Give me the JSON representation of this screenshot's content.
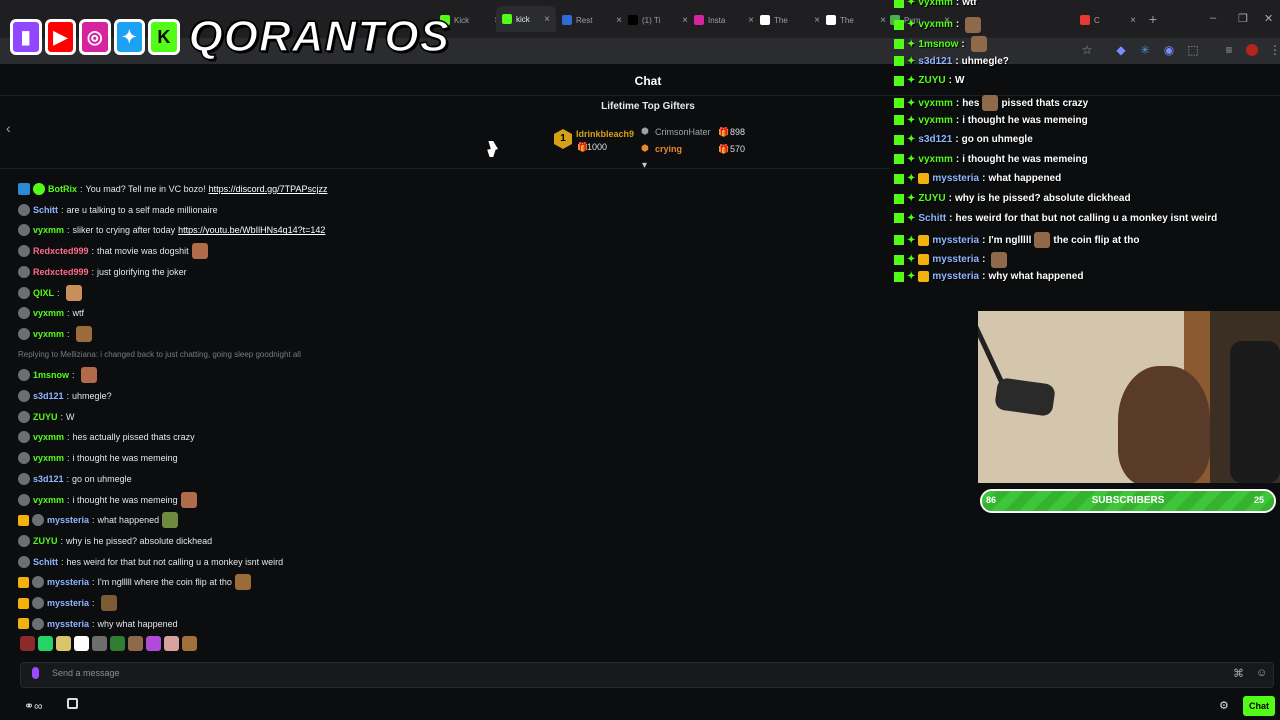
{
  "browser": {
    "tabs": [
      {
        "label": "Kick",
        "favicon_color": "#53fc18"
      },
      {
        "label": "kick",
        "favicon_color": "#53fc18",
        "active": true
      },
      {
        "label": "Rest",
        "favicon_color": "#2f6bd6"
      },
      {
        "label": "(1) Ti",
        "favicon_color": "#000000"
      },
      {
        "label": "Insta",
        "favicon_color": "#d6249f"
      },
      {
        "label": "The",
        "favicon_color": "#ffffff"
      },
      {
        "label": "The",
        "favicon_color": "#ffffff"
      },
      {
        "label": "Pum",
        "favicon_color": "#4caf50"
      },
      {
        "label": "C",
        "favicon_color": "#e53935"
      }
    ],
    "new_tab": "+",
    "window_min": "–",
    "window_max": "❐",
    "window_close": "✕"
  },
  "logo": {
    "text": "QORANTOS"
  },
  "chat": {
    "title": "Chat",
    "gifters_title": "Lifetime Top Gifters",
    "gifters": [
      {
        "rank": "1",
        "name": "Idrinkbleach9",
        "count": "1000",
        "color": "#d4a017"
      },
      {
        "name": "CrimsonHater",
        "count": "898",
        "color": "#9ea3a8"
      },
      {
        "name": "crying",
        "count": "570",
        "color": "#e6872e"
      }
    ],
    "messages": [
      {
        "user": "BotRix",
        "color": "#53fc18",
        "text": "You mad? Tell me in VC bozo! ",
        "link": "https://discord.gg/7TPAPscjzz",
        "badge": "bot"
      },
      {
        "user": "Schitt",
        "color": "#8fb6ff",
        "text": "are u talking to a self made millionaire"
      },
      {
        "user": "vyxmm",
        "color": "#53fc18",
        "text": "sliker to crying after today ",
        "link": "https://youtu.be/WbIlHNs4q14?t=142"
      },
      {
        "user": "Redxcted999",
        "color": "#ff6b8a",
        "text": "that movie was dogshit"
      },
      {
        "user": "Redxcted999",
        "color": "#ff6b8a",
        "text": "just glorifying the joker"
      },
      {
        "user": "QIXL",
        "color": "#53fc18",
        "text": ""
      },
      {
        "user": "vyxmm",
        "color": "#53fc18",
        "text": "wtf"
      },
      {
        "user": "vyxmm",
        "color": "#53fc18",
        "text": ""
      },
      {
        "reply": "Replying to Melliziana: i changed back to just chatting, going sleep goodnight all"
      },
      {
        "user": "1msnow",
        "color": "#53fc18",
        "text": ""
      },
      {
        "user": "s3d121",
        "color": "#8fb6ff",
        "text": "uhmegle?"
      },
      {
        "user": "ZUYU",
        "color": "#53fc18",
        "text": "W"
      },
      {
        "user": "vyxmm",
        "color": "#53fc18",
        "text": "hes actually pissed thats crazy"
      },
      {
        "user": "vyxmm",
        "color": "#53fc18",
        "text": "i thought he was memeing"
      },
      {
        "user": "s3d121",
        "color": "#8fb6ff",
        "text": "go on uhmegle"
      },
      {
        "user": "vyxmm",
        "color": "#53fc18",
        "text": "i thought he was memeing"
      },
      {
        "user": "myssteria",
        "color": "#8fb6ff",
        "text": "what happened",
        "crown": true
      },
      {
        "user": "ZUYU",
        "color": "#53fc18",
        "text": "why is he pissed? absolute dickhead"
      },
      {
        "user": "Schitt",
        "color": "#8fb6ff",
        "text": "hes weird for that but not calling u a monkey isnt weird"
      },
      {
        "user": "myssteria",
        "color": "#8fb6ff",
        "text": "I'm nglllll where the coin flip at tho",
        "crown": true
      },
      {
        "user": "myssteria",
        "color": "#8fb6ff",
        "text": "",
        "crown": true
      },
      {
        "user": "myssteria",
        "color": "#8fb6ff",
        "text": "why what happened",
        "crown": true
      }
    ],
    "send_placeholder": "Send a message",
    "chat_button": "Chat"
  },
  "overlay": {
    "messages": [
      {
        "user": "vyxmm",
        "color": "#53fc18",
        "text": "wtf"
      },
      {
        "user": "vyxmm",
        "color": "#53fc18",
        "text": ""
      },
      {
        "user": "1msnow",
        "color": "#53fc18",
        "text": ""
      },
      {
        "user": "s3d121",
        "color": "#8fb6ff",
        "text": "uhmegle?"
      },
      {
        "user": "ZUYU",
        "color": "#53fc18",
        "text": "W"
      },
      {
        "user": "vyxmm",
        "color": "#53fc18",
        "text": "hes",
        "text2": "pissed thats crazy"
      },
      {
        "user": "vyxmm",
        "color": "#53fc18",
        "text": "i thought he was memeing"
      },
      {
        "user": "s3d121",
        "color": "#8fb6ff",
        "text": "go on uhmegle"
      },
      {
        "user": "vyxmm",
        "color": "#53fc18",
        "text": "i thought he was memeing"
      },
      {
        "user": "myssteria",
        "color": "#8fb6ff",
        "text": "what happened",
        "crown": true
      },
      {
        "user": "ZUYU",
        "color": "#53fc18",
        "text": "why is he pissed? absolute dickhead"
      },
      {
        "user": "Schitt",
        "color": "#8fb6ff",
        "text": "hes weird for that but not calling u a monkey isnt weird"
      },
      {
        "user": "myssteria",
        "color": "#8fb6ff",
        "text": "I'm nglllll",
        "text2": "the coin flip at tho",
        "crown": true
      },
      {
        "user": "myssteria",
        "color": "#8fb6ff",
        "text": "",
        "crown": true
      },
      {
        "user": "myssteria",
        "color": "#8fb6ff",
        "text": "why what happened",
        "crown": true
      }
    ]
  },
  "subs": {
    "current": "86",
    "label": "SUBSCRIBERS",
    "goal": "25",
    "progress": 1.0
  }
}
